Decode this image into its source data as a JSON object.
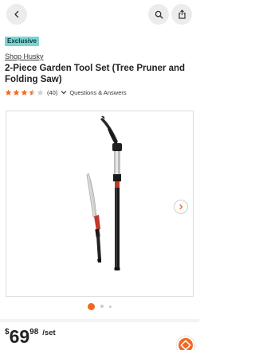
{
  "header": {
    "back_icon": "chevron-left-icon",
    "search_icon": "search-icon",
    "cart_icon": "shopping-bag-icon"
  },
  "product": {
    "badge": "Exclusive",
    "brand": "Shop Husky",
    "title": "2-Piece Garden Tool Set (Tree Pruner and Folding Saw)",
    "rating": 3.5,
    "review_count": "(40)",
    "qa_label": "Questions & Answers"
  },
  "gallery": {
    "current_index": 1,
    "total_dots": 3
  },
  "price": {
    "currency": "$",
    "dollars": "69",
    "cents": "98",
    "unit": "/set"
  },
  "colors": {
    "accent": "#f26722",
    "badge_bg": "#7dd3d3",
    "star": "#f26722"
  }
}
